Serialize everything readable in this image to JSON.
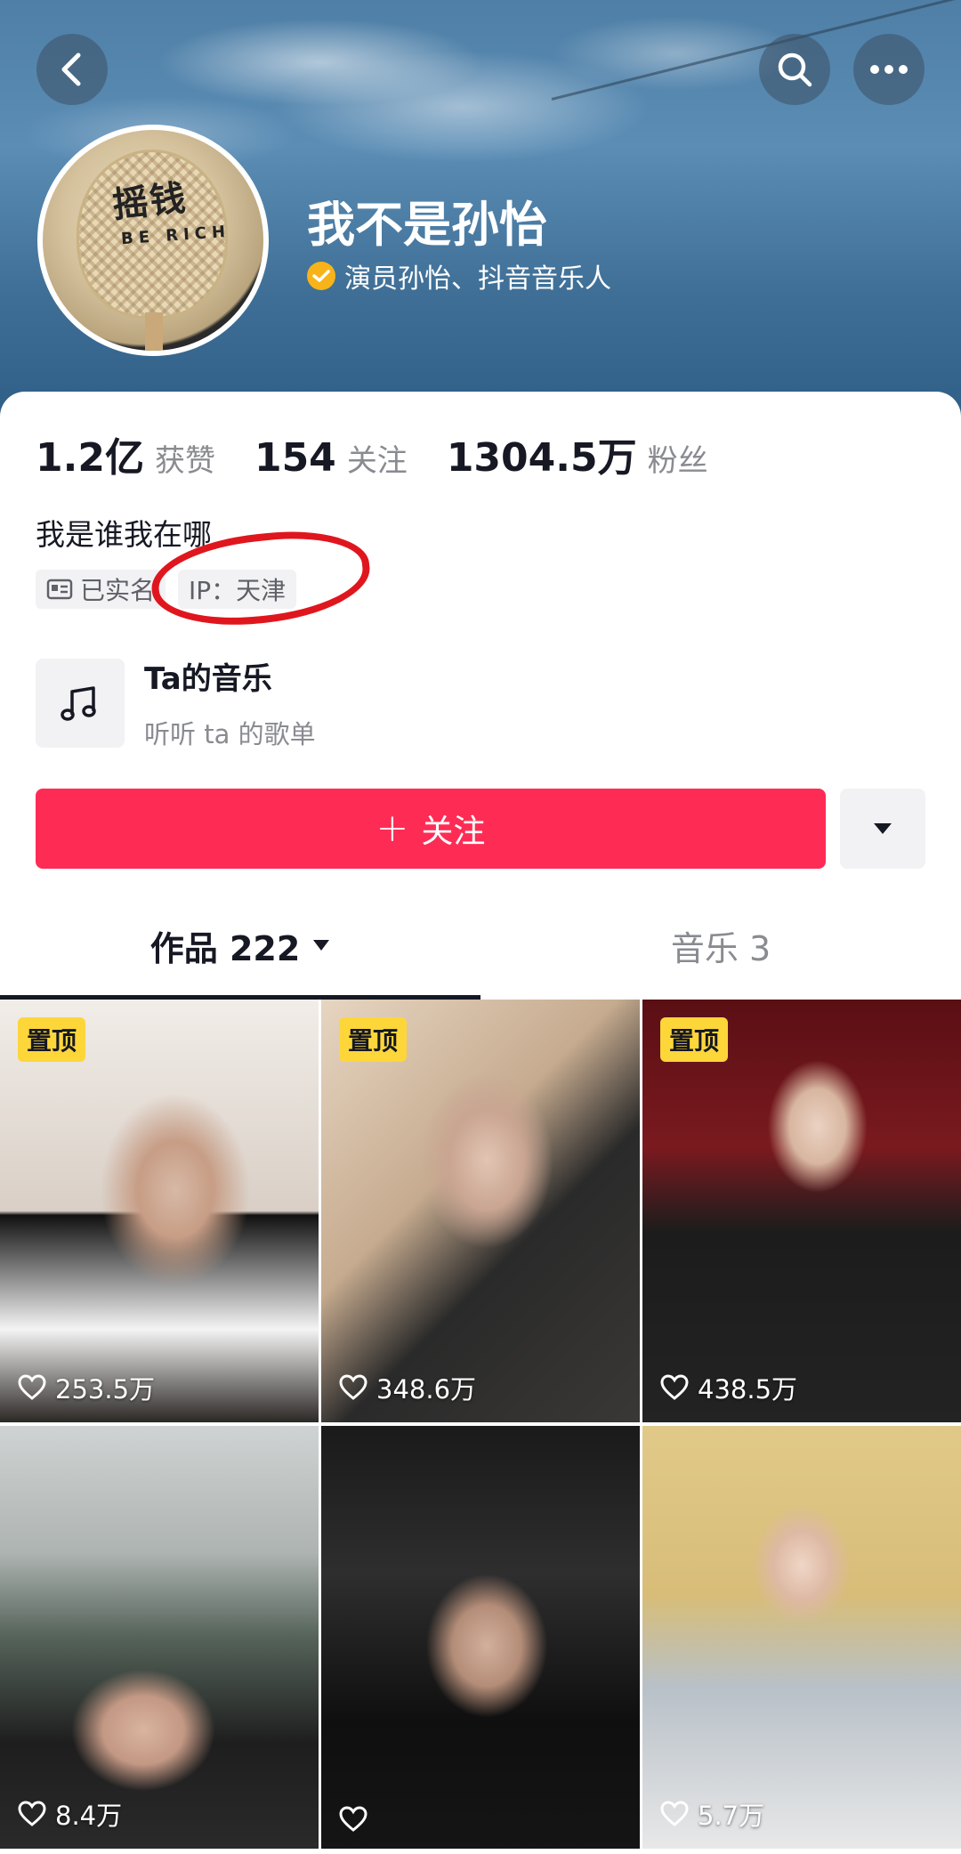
{
  "header": {
    "username": "我不是孙怡",
    "verification": "演员孙怡、抖音音乐人",
    "avatar_text": "摇钱",
    "avatar_subtext": "BE RICH",
    "icons": {
      "back": "chevron-left-icon",
      "search": "search-icon",
      "more": "more-dots-icon",
      "verify": "verified-check-icon"
    },
    "colors": {
      "verify_badge": "#f8b318"
    }
  },
  "stats": [
    {
      "value": "1.2亿",
      "label": "获赞"
    },
    {
      "value": "154",
      "label": "关注"
    },
    {
      "value": "1304.5万",
      "label": "粉丝"
    }
  ],
  "bio": "我是谁我在哪",
  "tags": {
    "realname": "已实名",
    "ip": "IP：天津"
  },
  "music": {
    "title": "Ta的音乐",
    "subtitle": "听听 ta 的歌单"
  },
  "actions": {
    "follow_plus": "+",
    "follow_label": "关注",
    "accent_color": "#fe2c55"
  },
  "tabs": [
    {
      "label": "作品 222",
      "active": true
    },
    {
      "label": "音乐 3",
      "active": false
    }
  ],
  "videos": [
    {
      "pinned_label": "置顶",
      "likes": "253.5万"
    },
    {
      "pinned_label": "置顶",
      "likes": "348.6万"
    },
    {
      "pinned_label": "置顶",
      "likes": "438.5万"
    },
    {
      "likes": "8.4万"
    },
    {
      "likes": ""
    },
    {
      "likes": "5.7万"
    }
  ]
}
